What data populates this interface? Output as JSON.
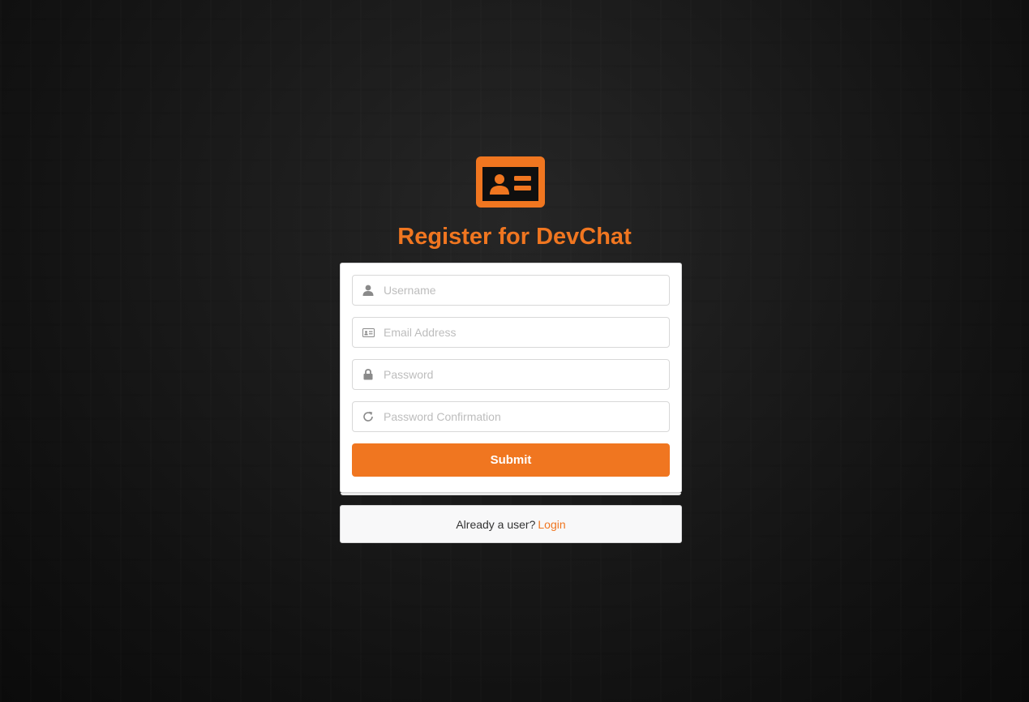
{
  "brand": {
    "title": "Register for DevChat",
    "accent_color": "#f07620",
    "logo_icon": "id-card-icon"
  },
  "form": {
    "fields": [
      {
        "placeholder": "Username",
        "value": "",
        "icon": "user-icon",
        "type": "text"
      },
      {
        "placeholder": "Email Address",
        "value": "",
        "icon": "id-badge-icon",
        "type": "email"
      },
      {
        "placeholder": "Password",
        "value": "",
        "icon": "lock-icon",
        "type": "password"
      },
      {
        "placeholder": "Password Confirmation",
        "value": "",
        "icon": "refresh-icon",
        "type": "password"
      }
    ],
    "submit_label": "Submit"
  },
  "footer": {
    "message": "Already a user?",
    "link_label": "Login"
  }
}
